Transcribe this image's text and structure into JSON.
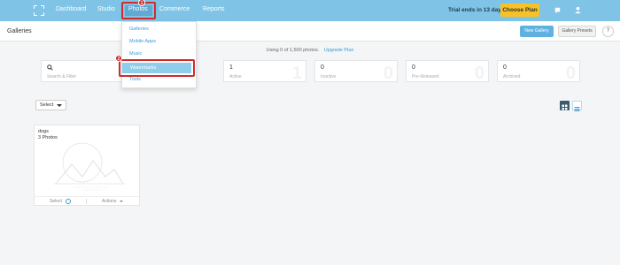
{
  "nav": {
    "items": [
      "Dashboard",
      "Studio",
      "Photos",
      "Commerce",
      "Reports"
    ],
    "active": "Photos"
  },
  "trial": {
    "text": "Trial ends in 13 days",
    "button": "Choose Plan"
  },
  "header": {
    "title": "Galleries",
    "new_gallery": "New Gallery",
    "gallery_presets": "Gallery Presets",
    "help": "?"
  },
  "usage": {
    "text": "Using 0 of 1,500 photos.",
    "link": "Upgrade Plan"
  },
  "search": {
    "placeholder": "Search & Filter"
  },
  "stats": [
    {
      "value": "1",
      "label": "Active",
      "big": "1"
    },
    {
      "value": "0",
      "label": "Inactive",
      "big": "0"
    },
    {
      "value": "0",
      "label": "Pre-Released",
      "big": "0"
    },
    {
      "value": "0",
      "label": "Archived",
      "big": "0"
    }
  ],
  "dropdown": {
    "items": [
      "Galleries",
      "Mobile Apps",
      "Music",
      "Watermarks",
      "Tools"
    ],
    "highlighted": "Watermarks"
  },
  "toolbar": {
    "select_label": "Select"
  },
  "gallery": {
    "title": "dogs",
    "count": "3 Photos",
    "select_label": "Select",
    "actions_label": "Actions"
  },
  "annotations": [
    "1",
    "2"
  ],
  "colors": {
    "topbar": "#7fc4e7",
    "accent": "#3a9bd6",
    "choose_plan": "#f6c228",
    "highlight_border": "#d22b2b"
  }
}
